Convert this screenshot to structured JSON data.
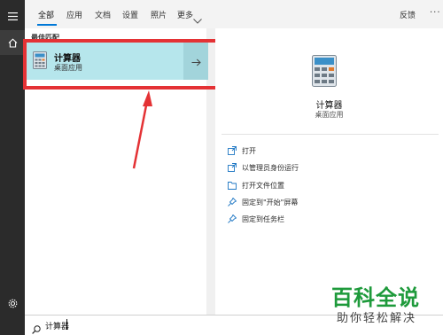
{
  "tabs": [
    {
      "label": "全部",
      "active": true
    },
    {
      "label": "应用"
    },
    {
      "label": "文档"
    },
    {
      "label": "设置"
    },
    {
      "label": "照片"
    },
    {
      "label": "更多"
    }
  ],
  "header": {
    "feedback_label": "反馈",
    "more_label": "···"
  },
  "left_rail": {
    "icons": [
      "hamburger-icon",
      "home-icon",
      "settings-icon"
    ]
  },
  "results": {
    "section_label": "最佳匹配",
    "best_match": {
      "name": "计算器",
      "type": "桌面应用"
    }
  },
  "details": {
    "name": "计算器",
    "type": "桌面应用",
    "actions": [
      {
        "label": "打开",
        "icon": "open-icon"
      },
      {
        "label": "以管理员身份运行",
        "icon": "run-as-admin-icon"
      },
      {
        "label": "打开文件位置",
        "icon": "file-location-icon"
      },
      {
        "label": "固定到\"开始\"屏幕",
        "icon": "pin-start-icon"
      },
      {
        "label": "固定到任务栏",
        "icon": "pin-taskbar-icon"
      }
    ]
  },
  "search": {
    "value": "计算器"
  },
  "watermark": {
    "title": "百科全说",
    "subtitle": "助你轻松解决"
  },
  "colors": {
    "selection": "#b6e6ec",
    "highlight_frame": "#e43235",
    "accent": "#0078d7",
    "watermark": "#1e9a3b"
  }
}
